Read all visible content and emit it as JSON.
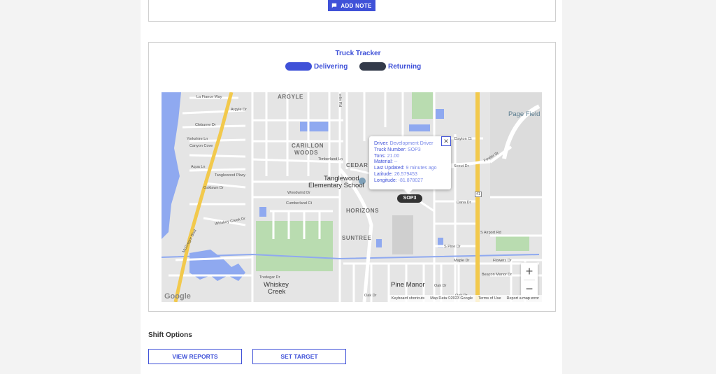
{
  "notes": {
    "add_note_label": "ADD NOTE",
    "icon": "comment-icon"
  },
  "tracker": {
    "title": "Truck Tracker",
    "legend": [
      {
        "label": "Delivering",
        "color": "#3f51d8"
      },
      {
        "label": "Returning",
        "color": "#333a4a"
      }
    ]
  },
  "map": {
    "labels": {
      "argyle": "ARGYLE",
      "carillon": "CARILLON",
      "woods": "WOODS",
      "cedar": "CEDAR B",
      "horizons": "HORIZONS",
      "suntree": "SUNTREE",
      "page_field": "Page Field",
      "tanglewood_school_1": "Tanglewood",
      "tanglewood_school_2": "Elementary School",
      "whiskey_1": "Whiskey",
      "whiskey_2": "Creek",
      "pine_manor": "Pine Manor",
      "la_fiance": "La Fiance Way",
      "argyle_dr": "Argyle Dr",
      "cleburne": "Cleburne Dr",
      "yorkshire": "Yorkshire Ln",
      "canyon": "Canyon Cove",
      "aqua": "Aqua Ln",
      "tanglewood_pkwy": "Tanglewood Pkwy",
      "oaklawn": "Oaklawn Dr",
      "whiskey_creek_dr": "Whiskey Creek Dr",
      "mcgregor": "McGregor Blvd",
      "woodwind": "Woodwind Dr",
      "cumberland": "Cumberland Ct",
      "timberland": "Timberland Ln",
      "clayton": "Clayton Ct",
      "scout": "Scout Dr",
      "fowler": "Fowler St",
      "dana": "Dana Dr",
      "airport": "S Airport Rd",
      "pine_dr": "S Pine Dr",
      "maple": "Maple Dr",
      "flowers": "Flowers Dr",
      "beacon": "Beacon Manor Dr",
      "tredegar": "Tredegar Dr",
      "oak_dr_1": "Oak Dr",
      "oak_dr_2": "Oak Dr",
      "oak_dr_3": "Oak Dr",
      "route_41": "41",
      "evelyn": "erlin Rd"
    },
    "popup": {
      "driver_label": "Driver:",
      "driver": "Development Driver",
      "truck_label": "Truck Number:",
      "truck": "SOP3",
      "tons_label": "Tons:",
      "tons": "21.00",
      "material_label": "Material:",
      "material": "--",
      "updated_label": "Last Updated:",
      "updated": "9 minutes ago",
      "lat_label": "Latitude:",
      "lat": "26.579453",
      "lon_label": "Longitude:",
      "lon": "-81.878027",
      "close": "✕"
    },
    "truck_marker": "SOP3",
    "zoom_in": "+",
    "zoom_out": "−",
    "google": "Google",
    "attribution": {
      "shortcuts": "Keyboard shortcuts",
      "data": "Map Data ©2023 Google",
      "terms": "Terms of Use",
      "report": "Report a map error"
    }
  },
  "shift": {
    "title": "Shift Options",
    "view_reports": "VIEW REPORTS",
    "set_target": "SET TARGET"
  }
}
